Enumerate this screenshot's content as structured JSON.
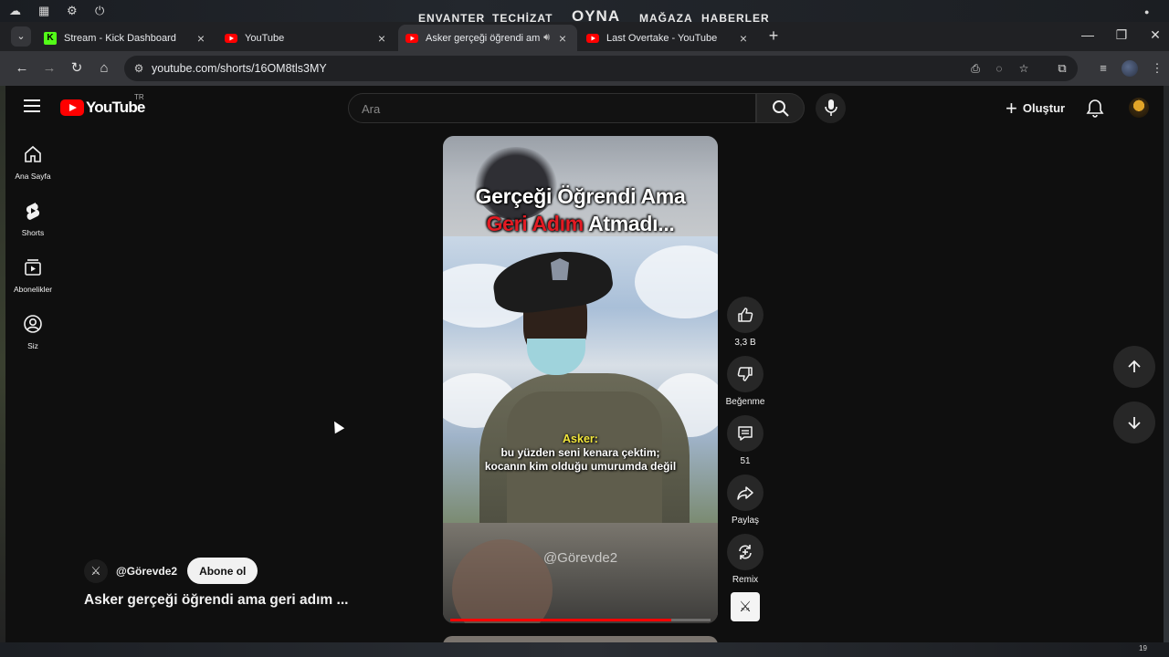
{
  "desktop": {
    "menu": [
      "ENVANTER",
      "TEÇHİZAT",
      "OYNA",
      "MAĞAZA",
      "HABERLER"
    ],
    "clock": "19"
  },
  "browser": {
    "tabs": [
      {
        "title": "Stream - Kick Dashboard",
        "favicon": "kick-icon",
        "active": false
      },
      {
        "title": "YouTube",
        "favicon": "youtube-icon",
        "active": false
      },
      {
        "title": "Asker gerçeği öğrendi ama",
        "favicon": "youtube-icon",
        "active": true,
        "audio": true
      },
      {
        "title": "Last Overtake - YouTube",
        "favicon": "youtube-icon",
        "active": false
      }
    ],
    "url": "youtube.com/shorts/16OM8tls3MY"
  },
  "youtube": {
    "logo_text": "YouTube",
    "country": "TR",
    "search_placeholder": "Ara",
    "create_label": "Oluştur",
    "sidebar": [
      {
        "label": "Ana Sayfa",
        "icon": "home-icon"
      },
      {
        "label": "Shorts",
        "icon": "shorts-icon"
      },
      {
        "label": "Abonelikler",
        "icon": "subscriptions-icon"
      },
      {
        "label": "Siz",
        "icon": "you-icon"
      }
    ],
    "video": {
      "caption_line1": "Gerçeği Öğrendi Ama",
      "caption_line2_red": "Geri Adım",
      "caption_line2_rest": "Atmadı...",
      "speaker": "Asker:",
      "subtitle_line1": "bu yüzden seni kenara çektim;",
      "subtitle_line2": "kocanın kim olduğu umurumda değil",
      "watermark": "@Görevde2",
      "progress": 0.85
    },
    "actions": {
      "like_count": "3,3 B",
      "dislike_label": "Beğenme",
      "comment_count": "51",
      "share_label": "Paylaş",
      "remix_label": "Remix"
    },
    "channel": {
      "handle": "@Görevde2",
      "subscribe_label": "Abone ol",
      "title": "Asker gerçeği öğrendi ama geri adım ..."
    }
  }
}
